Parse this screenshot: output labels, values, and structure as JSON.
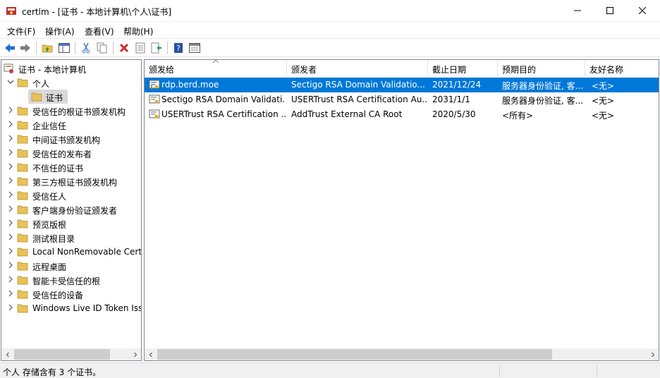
{
  "window": {
    "title": "certlm - [证书 - 本地计算机\\个人\\证书]"
  },
  "menu": {
    "file": "文件(F)",
    "action": "操作(A)",
    "view": "查看(V)",
    "help": "帮助(H)"
  },
  "toolbar": {
    "icons": [
      "back-icon",
      "forward-icon",
      "up-folder-icon",
      "show-hide-tree-icon",
      "cut-icon",
      "copy-icon",
      "delete-icon",
      "properties-icon",
      "export-icon",
      "help-icon",
      "console-icon"
    ]
  },
  "tree": {
    "root": "证书 - 本地计算机",
    "personal": "个人",
    "certs": "证书",
    "items": [
      "受信任的根证书颁发机构",
      "企业信任",
      "中间证书颁发机构",
      "受信任的发布者",
      "不信任的证书",
      "第三方根证书颁发机构",
      "受信任人",
      "客户端身份验证颁发者",
      "预览版根",
      "测试根目录",
      "Local NonRemovable Cert",
      "远程桌面",
      "智能卡受信任的根",
      "受信任的设备",
      "Windows Live ID Token Iss"
    ]
  },
  "list": {
    "columns": [
      "颁发给",
      "颁发者",
      "截止日期",
      "预期目的",
      "友好名称"
    ],
    "rows": [
      {
        "issued_to": "rdp.berd.moe",
        "issuer": "Sectigo RSA Domain Validatio...",
        "expires": "2021/12/24",
        "purpose": "服务器身份验证, 客...",
        "friendly": "<无>"
      },
      {
        "issued_to": "Sectigo RSA Domain Validati...",
        "issuer": "USERTrust RSA Certification Au...",
        "expires": "2031/1/1",
        "purpose": "服务器身份验证, 客...",
        "friendly": "<无>"
      },
      {
        "issued_to": "USERTrust RSA Certification ...",
        "issuer": "AddTrust External CA Root",
        "expires": "2020/5/30",
        "purpose": "<所有>",
        "friendly": "<无>"
      }
    ]
  },
  "status": {
    "text": "个人 存储含有 3 个证书。"
  },
  "colors": {
    "selection": "#0078d7",
    "folder": "#e8c257"
  }
}
